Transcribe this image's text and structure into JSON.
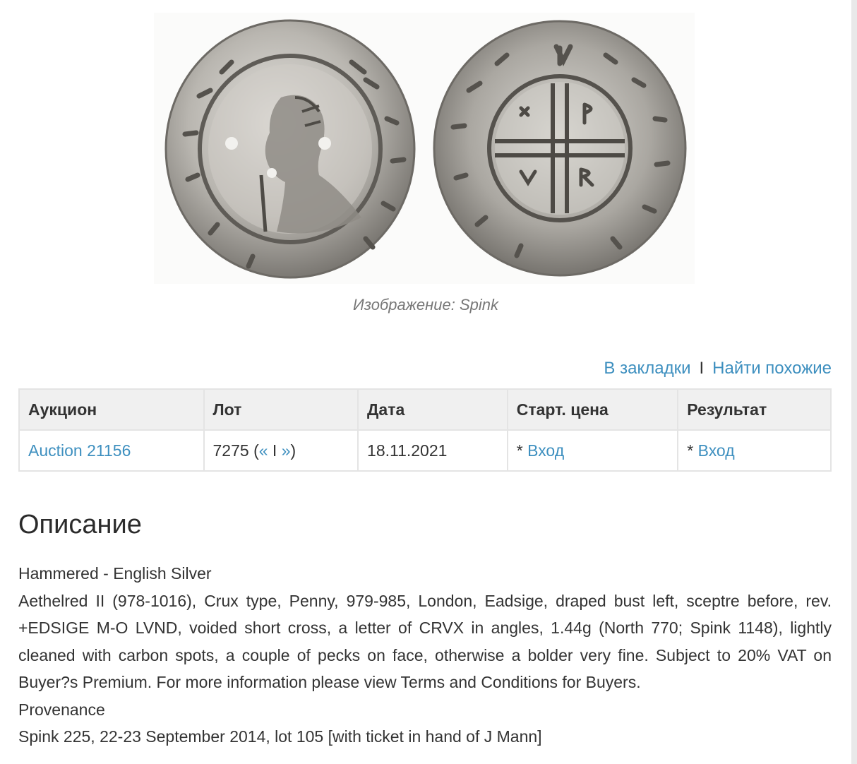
{
  "image": {
    "caption": "Изображение: Spink"
  },
  "actions": {
    "bookmark": "В закладки",
    "separator": "I",
    "find_similar": "Найти похожие"
  },
  "table": {
    "headers": {
      "auction": "Аукцион",
      "lot": "Лот",
      "date": "Дата",
      "start_price": "Старт. цена",
      "result": "Результат"
    },
    "row": {
      "auction": "Auction 21156",
      "lot_number": "7275 (",
      "lot_prev": "«",
      "lot_sep": " I ",
      "lot_next": "»",
      "lot_close": ")",
      "date": "18.11.2021",
      "star": "* ",
      "start_price_link": "Вход",
      "result_link": "Вход"
    }
  },
  "description": {
    "heading": "Описание",
    "category": "Hammered - English Silver",
    "text": "Aethelred II (978-1016), Crux type, Penny, 979-985, London, Eadsige, draped bust left, sceptre before, rev. +EDSIGE M-O LVND, voided short cross, a letter of CRVX in angles, 1.44g (North 770; Spink 1148), lightly cleaned with carbon spots, a couple of pecks on face, otherwise a bolder very fine. Subject to 20% VAT on Buyer?s Premium. For more information please view Terms and Conditions for Buyers.",
    "provenance_label": "Provenance",
    "provenance_text": "Spink 225, 22-23 September 2014, lot 105 [with ticket in hand of J Mann]"
  },
  "colors": {
    "link": "#3d8fbf",
    "header_bg": "#f0f0f0",
    "border": "#e4e4e4",
    "coin_silver": "#b8b6b2"
  }
}
